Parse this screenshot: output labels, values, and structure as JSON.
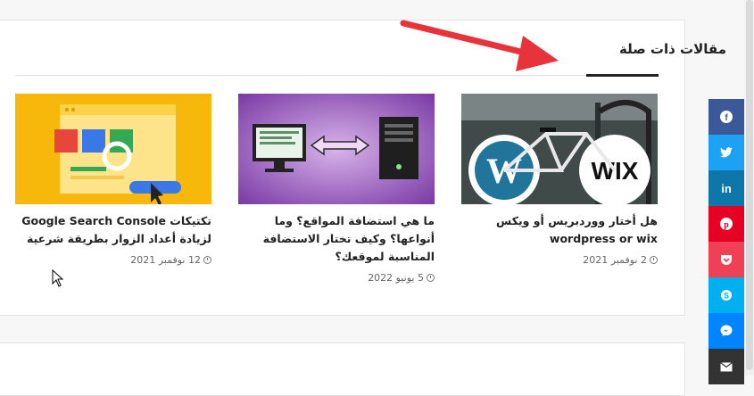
{
  "section": {
    "heading": "مقالات ذات صلة"
  },
  "posts": [
    {
      "title": "هل أختار ووردبريس أو ويكس wordpress or wix",
      "date": "2 نوفمبر 2021",
      "thumb_text": "WIX"
    },
    {
      "title": "ما هي استضافة المواقع؟ وما أنواعها؟ وكيف تختار الاستضافة المناسبة لموقعك؟",
      "date": "5 يونيو 2022"
    },
    {
      "title": "تكتيكات Google Search Console لزيادة أعداد الزوار بطريقة شرعية",
      "date": "12 نوفمبر 2021"
    }
  ],
  "share_buttons": [
    {
      "name": "facebook-icon",
      "color": "#3b5998",
      "glyph": "f"
    },
    {
      "name": "twitter-icon",
      "color": "#1da1f2",
      "glyph": "t"
    },
    {
      "name": "linkedin-icon",
      "color": "#0e76a8",
      "glyph": "in"
    },
    {
      "name": "pinterest-icon",
      "color": "#e60023",
      "glyph": "P"
    },
    {
      "name": "pocket-icon",
      "color": "#ef4056",
      "glyph": "♥"
    },
    {
      "name": "skype-icon",
      "color": "#00aff0",
      "glyph": "S"
    },
    {
      "name": "messenger-icon",
      "color": "#0084ff",
      "glyph": "m"
    },
    {
      "name": "email-icon",
      "color": "#333333",
      "glyph": "✉"
    }
  ],
  "colors": {
    "annotation_arrow": "#e8333a",
    "thumb_wix_bg": "#3f4a49",
    "thumb_hosting_bg": "#8c4fb0",
    "thumb_gsc_bg": "#f7b80b"
  }
}
